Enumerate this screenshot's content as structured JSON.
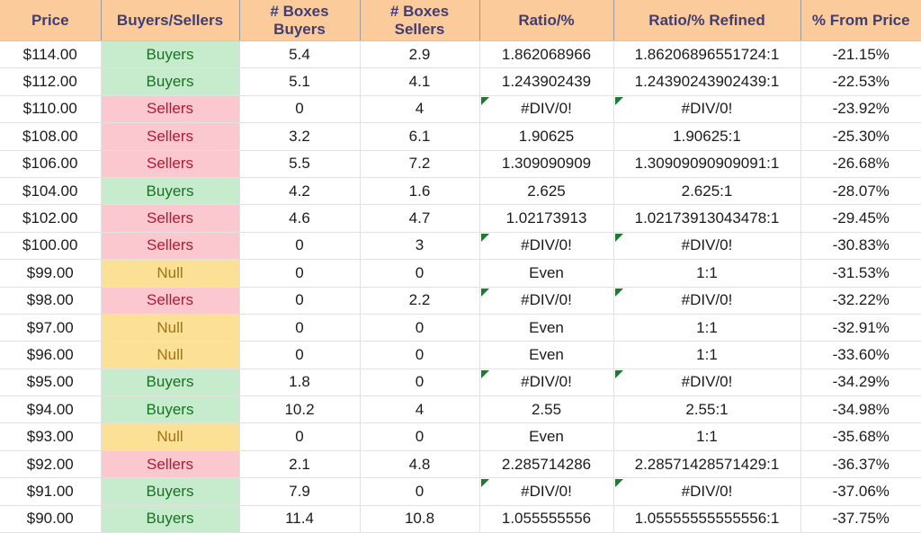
{
  "table": {
    "columns": [
      {
        "key": "price",
        "label_line1": "Price",
        "label_line2": ""
      },
      {
        "key": "signal",
        "label_line1": "Buyers/Sellers",
        "label_line2": ""
      },
      {
        "key": "boxes_buy",
        "label_line1": "# Boxes",
        "label_line2": "Buyers"
      },
      {
        "key": "boxes_sell",
        "label_line1": "# Boxes",
        "label_line2": "Sellers"
      },
      {
        "key": "ratio",
        "label_line1": "Ratio/%",
        "label_line2": ""
      },
      {
        "key": "ratio_ref",
        "label_line1": "Ratio/% Refined",
        "label_line2": ""
      },
      {
        "key": "pct_price",
        "label_line1": "% From Price",
        "label_line2": ""
      }
    ],
    "rows": [
      {
        "price": "$114.00",
        "signal": "Buyers",
        "boxes_buy": "5.4",
        "boxes_sell": "2.9",
        "ratio": "1.862068966",
        "ratio_ref": "1.86206896551724:1",
        "pct_price": "-21.15%",
        "error": false
      },
      {
        "price": "$112.00",
        "signal": "Buyers",
        "boxes_buy": "5.1",
        "boxes_sell": "4.1",
        "ratio": "1.243902439",
        "ratio_ref": "1.24390243902439:1",
        "pct_price": "-22.53%",
        "error": false
      },
      {
        "price": "$110.00",
        "signal": "Sellers",
        "boxes_buy": "0",
        "boxes_sell": "4",
        "ratio": "#DIV/0!",
        "ratio_ref": "#DIV/0!",
        "pct_price": "-23.92%",
        "error": true
      },
      {
        "price": "$108.00",
        "signal": "Sellers",
        "boxes_buy": "3.2",
        "boxes_sell": "6.1",
        "ratio": "1.90625",
        "ratio_ref": "1.90625:1",
        "pct_price": "-25.30%",
        "error": false
      },
      {
        "price": "$106.00",
        "signal": "Sellers",
        "boxes_buy": "5.5",
        "boxes_sell": "7.2",
        "ratio": "1.309090909",
        "ratio_ref": "1.30909090909091:1",
        "pct_price": "-26.68%",
        "error": false
      },
      {
        "price": "$104.00",
        "signal": "Buyers",
        "boxes_buy": "4.2",
        "boxes_sell": "1.6",
        "ratio": "2.625",
        "ratio_ref": "2.625:1",
        "pct_price": "-28.07%",
        "error": false
      },
      {
        "price": "$102.00",
        "signal": "Sellers",
        "boxes_buy": "4.6",
        "boxes_sell": "4.7",
        "ratio": "1.02173913",
        "ratio_ref": "1.02173913043478:1",
        "pct_price": "-29.45%",
        "error": false
      },
      {
        "price": "$100.00",
        "signal": "Sellers",
        "boxes_buy": "0",
        "boxes_sell": "3",
        "ratio": "#DIV/0!",
        "ratio_ref": "#DIV/0!",
        "pct_price": "-30.83%",
        "error": true
      },
      {
        "price": "$99.00",
        "signal": "Null",
        "boxes_buy": "0",
        "boxes_sell": "0",
        "ratio": "Even",
        "ratio_ref": "1:1",
        "pct_price": "-31.53%",
        "error": false
      },
      {
        "price": "$98.00",
        "signal": "Sellers",
        "boxes_buy": "0",
        "boxes_sell": "2.2",
        "ratio": "#DIV/0!",
        "ratio_ref": "#DIV/0!",
        "pct_price": "-32.22%",
        "error": true
      },
      {
        "price": "$97.00",
        "signal": "Null",
        "boxes_buy": "0",
        "boxes_sell": "0",
        "ratio": "Even",
        "ratio_ref": "1:1",
        "pct_price": "-32.91%",
        "error": false
      },
      {
        "price": "$96.00",
        "signal": "Null",
        "boxes_buy": "0",
        "boxes_sell": "0",
        "ratio": "Even",
        "ratio_ref": "1:1",
        "pct_price": "-33.60%",
        "error": false
      },
      {
        "price": "$95.00",
        "signal": "Buyers",
        "boxes_buy": "1.8",
        "boxes_sell": "0",
        "ratio": "#DIV/0!",
        "ratio_ref": "#DIV/0!",
        "pct_price": "-34.29%",
        "error": true
      },
      {
        "price": "$94.00",
        "signal": "Buyers",
        "boxes_buy": "10.2",
        "boxes_sell": "4",
        "ratio": "2.55",
        "ratio_ref": "2.55:1",
        "pct_price": "-34.98%",
        "error": false
      },
      {
        "price": "$93.00",
        "signal": "Null",
        "boxes_buy": "0",
        "boxes_sell": "0",
        "ratio": "Even",
        "ratio_ref": "1:1",
        "pct_price": "-35.68%",
        "error": false
      },
      {
        "price": "$92.00",
        "signal": "Sellers",
        "boxes_buy": "2.1",
        "boxes_sell": "4.8",
        "ratio": "2.285714286",
        "ratio_ref": "2.28571428571429:1",
        "pct_price": "-36.37%",
        "error": false
      },
      {
        "price": "$91.00",
        "signal": "Buyers",
        "boxes_buy": "7.9",
        "boxes_sell": "0",
        "ratio": "#DIV/0!",
        "ratio_ref": "#DIV/0!",
        "pct_price": "-37.06%",
        "error": true
      },
      {
        "price": "$90.00",
        "signal": "Buyers",
        "boxes_buy": "11.4",
        "boxes_sell": "10.8",
        "ratio": "1.055555556",
        "ratio_ref": "1.05555555555556:1",
        "pct_price": "-37.75%",
        "error": false
      }
    ]
  },
  "colors": {
    "header_bg": "#fbcb9b",
    "header_text": "#3f3d73",
    "buyers_bg": "#c6eccd",
    "buyers_text": "#16731f",
    "sellers_bg": "#fbc8d0",
    "sellers_text": "#b01933",
    "null_bg": "#fbe095",
    "null_text": "#9a7519",
    "error_flag": "#1e7a2e",
    "grid_line": "#e2e2e2"
  },
  "icons": {
    "error_flag": "error-flag-triangle-icon"
  }
}
